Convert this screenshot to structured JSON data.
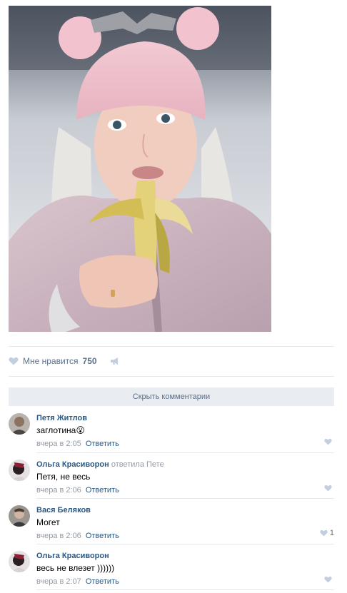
{
  "post": {
    "likes_label": "Мне нравится",
    "likes_count": "750",
    "hide_comments_label": "Скрыть комментарии"
  },
  "comments": [
    {
      "author": "Петя Житлов",
      "reply_to": "",
      "text": "заглотина😮",
      "time": "вчера в 2:05",
      "reply_label": "Ответить",
      "likes": ""
    },
    {
      "author": "Ольга Красиворон",
      "reply_to": "ответила Пете",
      "text": "Петя, не весь",
      "time": "вчера в 2:06",
      "reply_label": "Ответить",
      "likes": ""
    },
    {
      "author": "Вася Беляков",
      "reply_to": "",
      "text": "Могет",
      "time": "вчера в 2:06",
      "reply_label": "Ответить",
      "likes": "1"
    },
    {
      "author": "Ольга Красиворон",
      "reply_to": "",
      "text": "весь не влезет ))))))",
      "time": "вчера в 2:07",
      "reply_label": "Ответить",
      "likes": ""
    }
  ],
  "colors": {
    "link": "#2a5885",
    "muted": "#939aa6",
    "heart": "#c2cfde"
  }
}
